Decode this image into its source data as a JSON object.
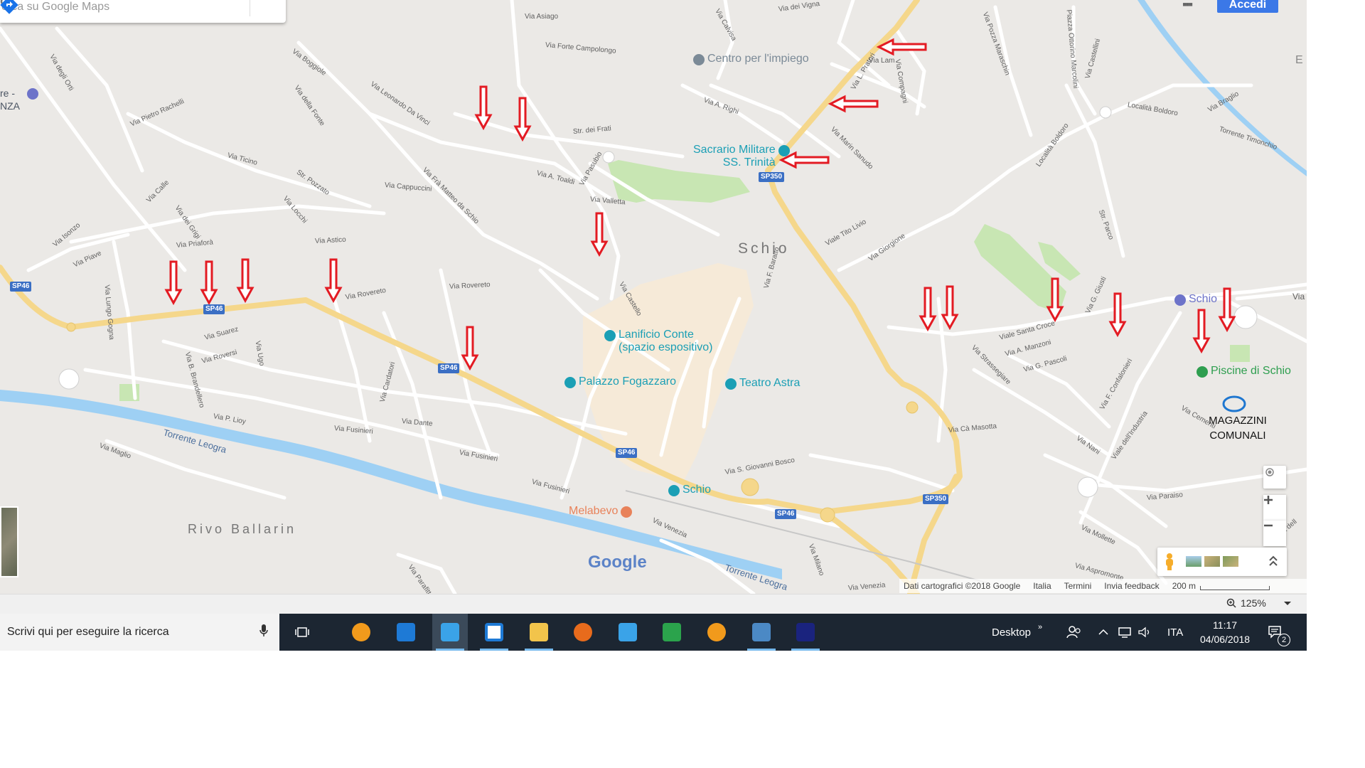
{
  "search": {
    "placeholder": "erca su Google Maps"
  },
  "header": {
    "signin_label": "Accedi",
    "apps_glyph": "▪▪▪"
  },
  "map": {
    "town_label": "Schio",
    "area_label": "Rivo Ballarin",
    "google_logo": "Google",
    "street_labels": [
      {
        "text": "Via Asiago"
      },
      {
        "text": "Via Forte Campolongo"
      },
      {
        "text": "Via Boggiole"
      },
      {
        "text": "Via della Fonte"
      },
      {
        "text": "Via Leonardo Da Vinci"
      },
      {
        "text": "Via degli Orti"
      },
      {
        "text": "Via Pietro Rachelli"
      },
      {
        "text": "Via Ticino"
      },
      {
        "text": "Str. Pozzato"
      },
      {
        "text": "Via Cappuccini"
      },
      {
        "text": "Via Frà Matteo da Schio"
      },
      {
        "text": "Via A. Toaldi"
      },
      {
        "text": "Str. dei Frati"
      },
      {
        "text": "Via Calle"
      },
      {
        "text": "Via dei Grigi"
      },
      {
        "text": "Via Locchi"
      },
      {
        "text": "Via Isonzo"
      },
      {
        "text": "Via Piave"
      },
      {
        "text": "Via Priaforà"
      },
      {
        "text": "Via Astico"
      },
      {
        "text": "Via Lungo Gogna"
      },
      {
        "text": "Via Rovereto"
      },
      {
        "text": "Via Rovereto"
      },
      {
        "text": "Via Pasubio"
      },
      {
        "text": "Via Valletta"
      },
      {
        "text": "Via A. Righi"
      },
      {
        "text": "Via Castello"
      },
      {
        "text": "Via F. Baratto"
      },
      {
        "text": "Via B. Brandellero"
      },
      {
        "text": "Via Suarez"
      },
      {
        "text": "Via Roversi"
      },
      {
        "text": "Via Ugo"
      },
      {
        "text": "Via Cardatori"
      },
      {
        "text": "Via P. Lioy"
      },
      {
        "text": "Via Fusinieri"
      },
      {
        "text": "Via Dante"
      },
      {
        "text": "Via Fusinieri"
      },
      {
        "text": "Via Fusinieri"
      },
      {
        "text": "Via Maglio"
      },
      {
        "text": "Via Venezia"
      },
      {
        "text": "Via Milano"
      },
      {
        "text": "Via Venezia"
      },
      {
        "text": "Via Parafitta"
      },
      {
        "text": "Via S. Giovanni Bosco"
      },
      {
        "text": "Viale Tito Livio"
      },
      {
        "text": "Via Giorgione"
      },
      {
        "text": "Via Marin Sanudo"
      },
      {
        "text": "Via dei Vigna"
      },
      {
        "text": "Via Calvisa"
      },
      {
        "text": "Via Pozza Maraschin"
      },
      {
        "text": "Piazza Ottorino Marcolini"
      },
      {
        "text": "Via Castellini"
      },
      {
        "text": "Località Boldoro"
      },
      {
        "text": "Località Boldoro"
      },
      {
        "text": "Via Braglio"
      },
      {
        "text": "Torrente Timonchio"
      },
      {
        "text": "Str. Parco"
      },
      {
        "text": "Viale Santa Croce"
      },
      {
        "text": "Via A. Manzoni"
      },
      {
        "text": "Via G. Pascoli"
      },
      {
        "text": "Via Strassegiare"
      },
      {
        "text": "Via G. Giusti"
      },
      {
        "text": "Via F. Confalonieri"
      },
      {
        "text": "Via Cà Masotta"
      },
      {
        "text": "Via Nani"
      },
      {
        "text": "Viale dell'Industria"
      },
      {
        "text": "Via Cementi"
      },
      {
        "text": "Via Paraiso"
      },
      {
        "text": "Via Mollette"
      },
      {
        "text": "Via Aspromonte"
      },
      {
        "text": "Via dell"
      },
      {
        "text": "Via"
      },
      {
        "text": "Via Compagni"
      },
      {
        "text": "Via L. Pratori"
      },
      {
        "text": "Via Lam"
      }
    ],
    "river_labels": [
      {
        "text": "Torrente Leogra"
      },
      {
        "text": "Torrente Leogra"
      }
    ],
    "road_badges": [
      {
        "text": "SP46"
      },
      {
        "text": "SP46"
      },
      {
        "text": "SP46"
      },
      {
        "text": "SP46"
      },
      {
        "text": "SP46"
      },
      {
        "text": "SP350"
      },
      {
        "text": "SP350"
      }
    ],
    "pois": [
      {
        "name": "Centro per l'impiego",
        "color": "#7b8a97"
      },
      {
        "name": "Sacrario Militare\nSS. Trinità",
        "color": "#1b9fb5"
      },
      {
        "name": "Lanificio Conte\n(spazio espositivo)",
        "color": "#1b9fb5"
      },
      {
        "name": "Palazzo Fogazzaro",
        "color": "#1b9fb5"
      },
      {
        "name": "Teatro Astra",
        "color": "#1b9fb5"
      },
      {
        "name": "Schio",
        "color": "#1b9fb5"
      },
      {
        "name": "Melabevo",
        "color": "#e8825a"
      },
      {
        "name": "Piscine di Schio",
        "color": "#2e9e4f"
      },
      {
        "name": "Schio",
        "color": "#6d73c9"
      }
    ],
    "edge_labels": [
      {
        "text": "re -"
      },
      {
        "text": "NZA"
      },
      {
        "text": "E"
      }
    ],
    "annotation": {
      "line1": "MAGAZZINI",
      "line2": "COMUNALI",
      "marker_color": "#1f77d0"
    },
    "arrow_color": "#e31b23",
    "arrow_count": 19
  },
  "attribution": {
    "data": "Dati cartografici ©2018 Google",
    "country": "Italia",
    "terms": "Termini",
    "feedback": "Invia feedback",
    "scale": "200 m"
  },
  "statusbar": {
    "zoom": "125%"
  },
  "taskbar": {
    "search_placeholder": "Scrivi qui per eseguire la ricerca",
    "desktop_label": "Desktop",
    "language": "ITA",
    "time": "11:17",
    "date": "04/06/2018",
    "notifications": "2",
    "apps": [
      {
        "name": "app-orange-icon"
      },
      {
        "name": "edge-icon"
      },
      {
        "name": "ie-icon"
      },
      {
        "name": "store-icon"
      },
      {
        "name": "file-explorer-icon"
      },
      {
        "name": "firefox-icon"
      },
      {
        "name": "ie-icon-2"
      },
      {
        "name": "recycle-icon"
      },
      {
        "name": "app-orange-icon-2"
      },
      {
        "name": "picture-icon"
      },
      {
        "name": "monitor-app-icon"
      }
    ]
  }
}
